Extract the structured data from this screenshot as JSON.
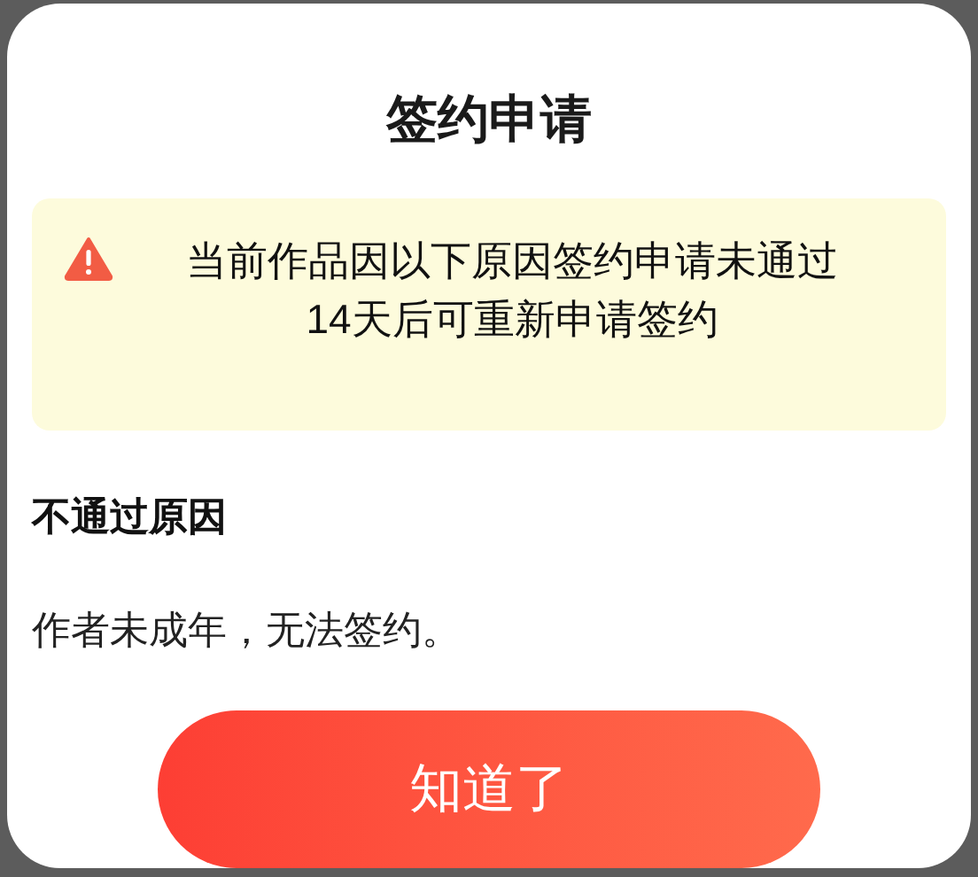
{
  "dialog": {
    "title": "签约申请",
    "notice": {
      "lines": [
        "当前作品因以下原因签约申请未通过",
        "14天后可重新申请签约"
      ]
    },
    "reason_heading": "不通过原因",
    "reason": "作者未成年，无法签约。",
    "button": "知道了"
  }
}
